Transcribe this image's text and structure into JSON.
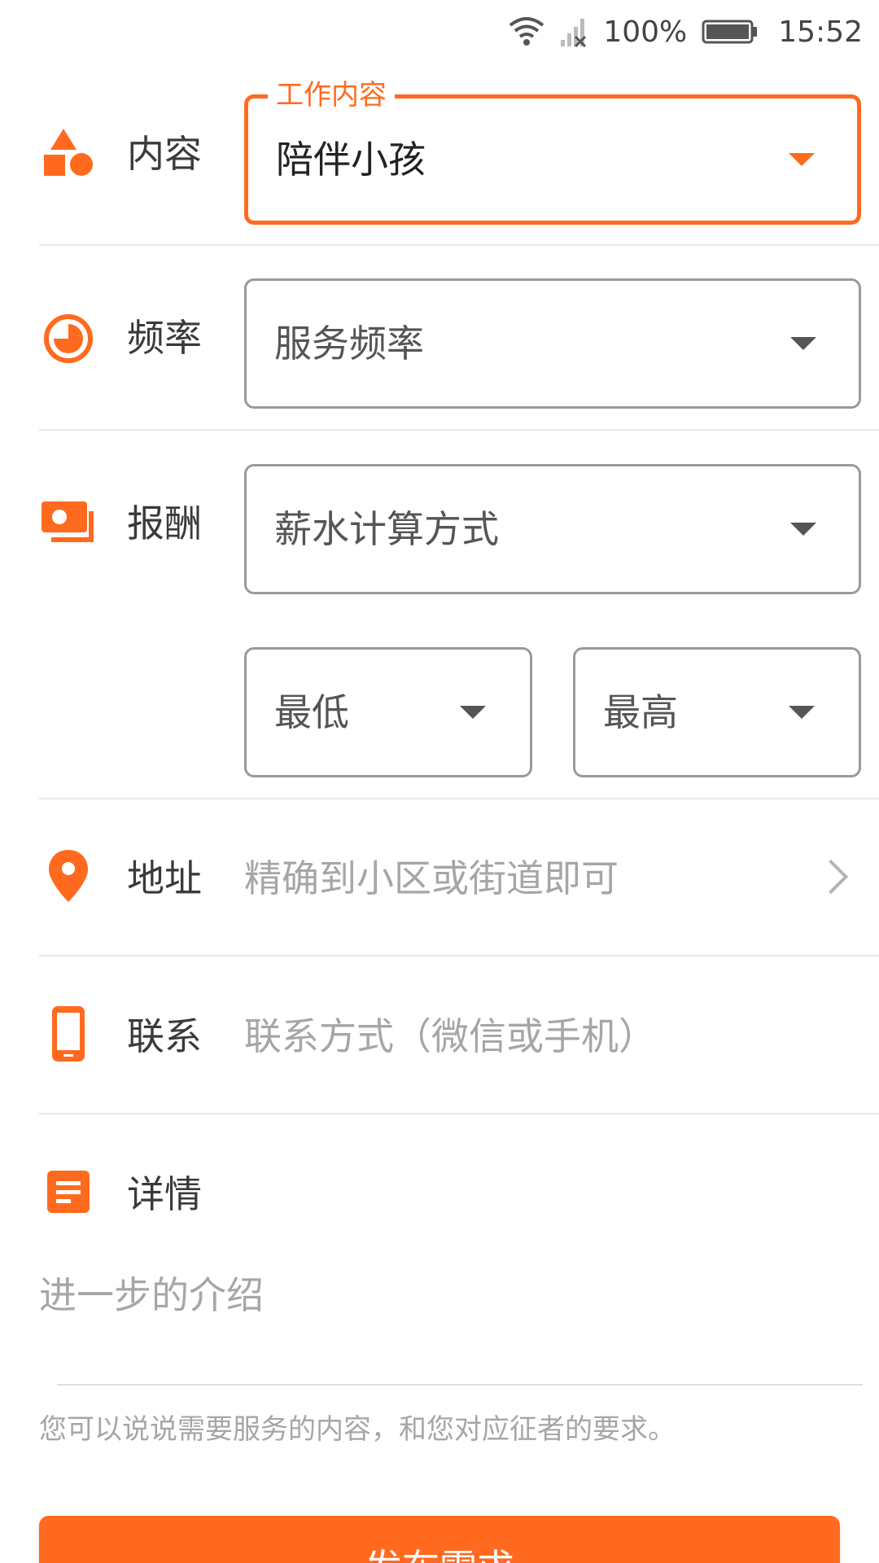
{
  "status_bar": {
    "battery": "100%",
    "time": "15:52"
  },
  "form": {
    "content": {
      "label": "内容",
      "float_label": "工作内容",
      "value": "陪伴小孩"
    },
    "frequency": {
      "label": "频率",
      "value": "服务频率"
    },
    "pay": {
      "label": "报酬",
      "method": "薪水计算方式",
      "min": "最低",
      "max": "最高"
    },
    "address": {
      "label": "地址",
      "placeholder": "精确到小区或街道即可"
    },
    "contact": {
      "label": "联系",
      "placeholder": "联系方式（微信或手机）"
    },
    "detail": {
      "label": "详情",
      "placeholder": "进一步的介绍",
      "helper": "您可以说说需要服务的内容，和您对应征者的要求。"
    },
    "submit_label": "发布需求"
  },
  "colors": {
    "accent": "#ff6a1f",
    "border": "#9a9a9a",
    "hint": "#a6a6a6"
  },
  "icons": [
    "wifi-icon",
    "signal-icon",
    "battery-icon",
    "shapes-icon",
    "clock-icon",
    "money-icon",
    "location-pin-icon",
    "phone-icon",
    "document-icon",
    "chevron-right-icon",
    "dropdown-arrow-icon"
  ]
}
